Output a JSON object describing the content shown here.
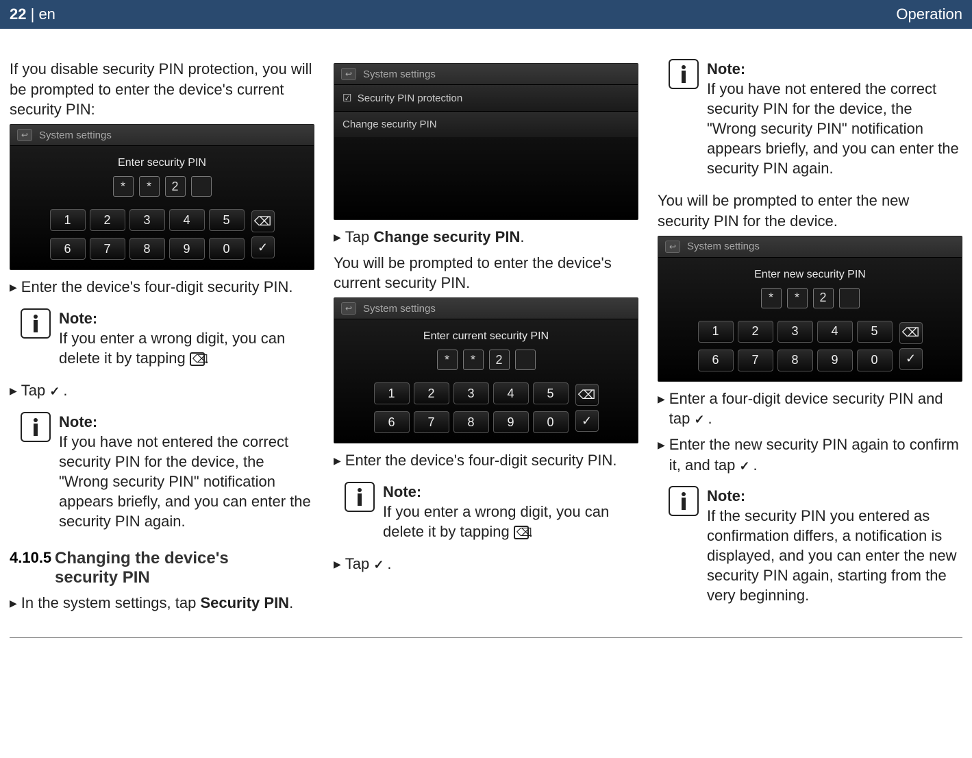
{
  "header": {
    "pagenum": "22",
    "lang": "en",
    "sep": " | ",
    "section": "Operation"
  },
  "col1": {
    "intro": "If you disable security PIN protection, you will be prompted to enter the device's current security PIN:",
    "device1": {
      "title": "System settings",
      "prompt": "Enter security PIN",
      "pins": [
        "*",
        "*",
        "2",
        ""
      ],
      "row1": [
        "1",
        "2",
        "3",
        "4",
        "5"
      ],
      "row2": [
        "6",
        "7",
        "8",
        "9",
        "0"
      ],
      "side": [
        "⌫",
        "✓"
      ]
    },
    "step1": "Enter the device's four-digit security PIN.",
    "note1": {
      "title": "Note:",
      "body_a": "If you enter a wrong digit, you can delete it by tapping ",
      "body_b": "."
    },
    "step2a": "Tap ",
    "step2b": ".",
    "note2": {
      "title": "Note:",
      "body": "If you have not entered the correct security PIN for the device, the \"Wrong security PIN\" notification appears briefly, and you can enter the security PIN again."
    },
    "sect": {
      "num": "4.10.5",
      "title": "Changing the device's security PIN"
    },
    "step3a": "In the system settings, tap ",
    "step3b": "Security PIN",
    "step3c": "."
  },
  "col2": {
    "device_menu": {
      "title": "System settings",
      "item1": "Security PIN protection",
      "item2": "Change security PIN"
    },
    "step1a": "Tap ",
    "step1b": "Change security PIN",
    "step1c": ".",
    "after1": "You will be prompted to enter the device's current security PIN.",
    "device2": {
      "title": "System settings",
      "prompt": "Enter current security PIN",
      "pins": [
        "*",
        "*",
        "2",
        ""
      ],
      "row1": [
        "1",
        "2",
        "3",
        "4",
        "5"
      ],
      "row2": [
        "6",
        "7",
        "8",
        "9",
        "0"
      ],
      "side": [
        "⌫",
        "✓"
      ]
    },
    "step2": "Enter the device's four-digit security PIN.",
    "note1": {
      "title": "Note:",
      "body_a": "If you enter a wrong digit, you can delete it by tapping ",
      "body_b": "."
    },
    "step3a": "Tap ",
    "step3b": "."
  },
  "col3": {
    "note1": {
      "title": "Note:",
      "body": "If you have not entered the correct security PIN for the device, the \"Wrong security PIN\" notification appears briefly, and you can enter the security PIN again."
    },
    "after1": "You will be prompted to enter the new security PIN for the device.",
    "device3": {
      "title": "System settings",
      "prompt": "Enter new security PIN",
      "pins": [
        "*",
        "*",
        "2",
        ""
      ],
      "row1": [
        "1",
        "2",
        "3",
        "4",
        "5"
      ],
      "row2": [
        "6",
        "7",
        "8",
        "9",
        "0"
      ],
      "side": [
        "⌫",
        "✓"
      ]
    },
    "step1a": "Enter a four-digit device security PIN and tap ",
    "step1b": ".",
    "step2a": "Enter the new security PIN again to confirm it, and tap ",
    "step2b": ".",
    "note2": {
      "title": "Note:",
      "body": "If the security PIN you entered as confirmation differs, a notification is displayed, and you can enter the new security PIN again, starting from the very beginning."
    }
  }
}
